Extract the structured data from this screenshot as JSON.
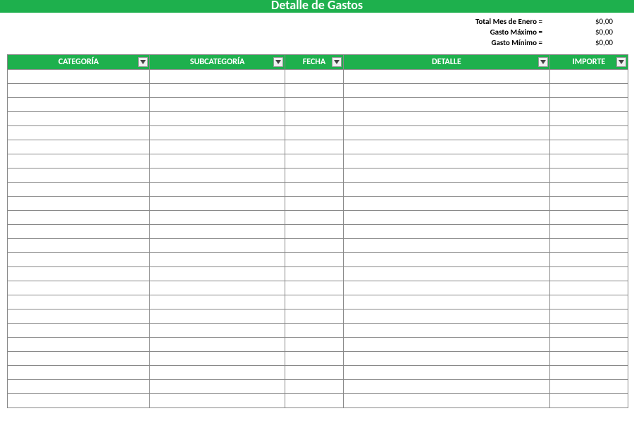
{
  "title": "Detalle de Gastos",
  "summary": {
    "rows": [
      {
        "label": "Total Mes de Enero =",
        "value": "$0,00"
      },
      {
        "label": "Gasto Máximo =",
        "value": "$0,00"
      },
      {
        "label": "Gasto Mínimo =",
        "value": "$0,00"
      }
    ]
  },
  "columns": [
    {
      "label": "CATEGORÍA"
    },
    {
      "label": "SUBCATEGORÍA"
    },
    {
      "label": "FECHA"
    },
    {
      "label": "DETALLE"
    },
    {
      "label": "IMPORTE"
    }
  ],
  "rows": [
    [
      "",
      "",
      "",
      "",
      ""
    ],
    [
      "",
      "",
      "",
      "",
      ""
    ],
    [
      "",
      "",
      "",
      "",
      ""
    ],
    [
      "",
      "",
      "",
      "",
      ""
    ],
    [
      "",
      "",
      "",
      "",
      ""
    ],
    [
      "",
      "",
      "",
      "",
      ""
    ],
    [
      "",
      "",
      "",
      "",
      ""
    ],
    [
      "",
      "",
      "",
      "",
      ""
    ],
    [
      "",
      "",
      "",
      "",
      ""
    ],
    [
      "",
      "",
      "",
      "",
      ""
    ],
    [
      "",
      "",
      "",
      "",
      ""
    ],
    [
      "",
      "",
      "",
      "",
      ""
    ],
    [
      "",
      "",
      "",
      "",
      ""
    ],
    [
      "",
      "",
      "",
      "",
      ""
    ],
    [
      "",
      "",
      "",
      "",
      ""
    ],
    [
      "",
      "",
      "",
      "",
      ""
    ],
    [
      "",
      "",
      "",
      "",
      ""
    ],
    [
      "",
      "",
      "",
      "",
      ""
    ],
    [
      "",
      "",
      "",
      "",
      ""
    ],
    [
      "",
      "",
      "",
      "",
      ""
    ],
    [
      "",
      "",
      "",
      "",
      ""
    ],
    [
      "",
      "",
      "",
      "",
      ""
    ],
    [
      "",
      "",
      "",
      "",
      ""
    ],
    [
      "",
      "",
      "",
      "",
      ""
    ]
  ]
}
